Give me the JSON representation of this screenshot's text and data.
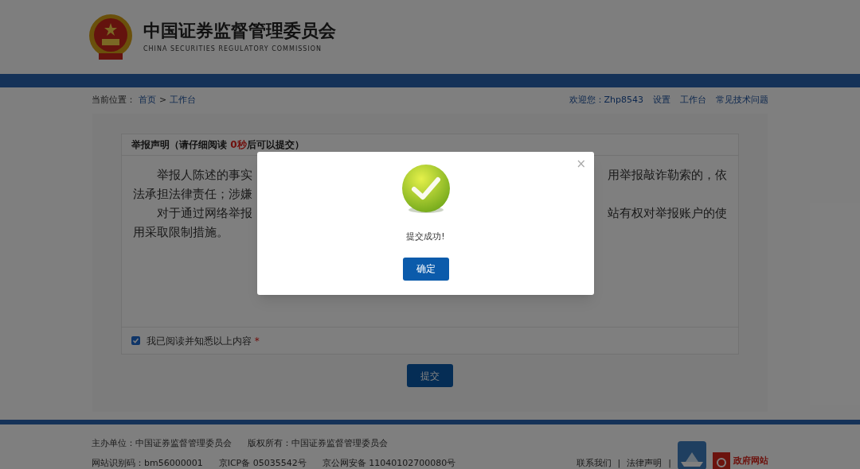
{
  "header": {
    "title": "中国证券监督管理委员会",
    "subtitle": "CHINA SECURITIES REGULATORY COMMISSION"
  },
  "breadcrumb": {
    "label": "当前位置：",
    "items": [
      "首页",
      "工作台"
    ],
    "separator": ">"
  },
  "user_links": [
    "欢迎您：Zhp8543",
    "设置",
    "工作台",
    "常见技术问题"
  ],
  "statement": {
    "heading_prefix": "举报声明（请仔细阅读 ",
    "countdown": "0秒",
    "heading_suffix": "后可以提交）",
    "lines": [
      {
        "left": "举报人陈述的事实",
        "right": "用举报敲诈勒索的，依",
        "indent": true
      },
      {
        "left": "法承担法律责任；涉嫌",
        "indent": false
      },
      {
        "left": "对于通过网络举报",
        "right": "站有权对举报账户的使",
        "indent": true
      },
      {
        "left": "用采取限制措施。",
        "indent": false
      }
    ]
  },
  "agreement": {
    "label": "我已阅读并知悉以上内容",
    "required_mark": "*",
    "checked": true
  },
  "submit_button": "提交",
  "footer": {
    "row1": [
      "主办单位：中国证券监督管理委员会",
      "版权所有：中国证券监督管理委员会"
    ],
    "row2": [
      "网站识别码：bm56000001",
      "京ICP备 05035542号",
      "京公网安备 11040102700080号"
    ],
    "links": [
      "联系我们",
      "法律声明"
    ],
    "separator": "|",
    "gov_badge": "政府网站"
  },
  "dialog": {
    "close": "×",
    "message": "提交成功!",
    "ok_button": "确定"
  }
}
